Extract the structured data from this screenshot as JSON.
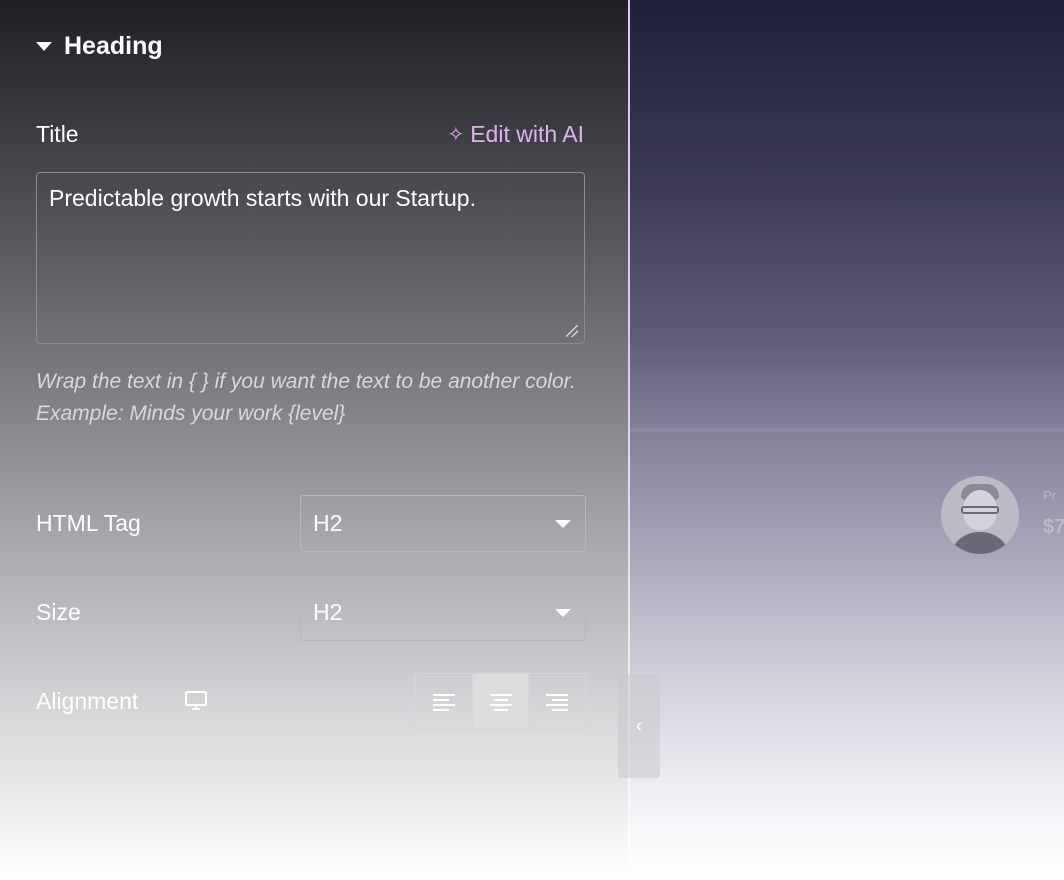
{
  "section": {
    "title": "Heading",
    "icon": "caret-down-icon"
  },
  "title_field": {
    "label": "Title",
    "ai_label": "Edit with AI",
    "ai_icon": "sparkle-icon",
    "value": "Predictable growth starts with our Startup."
  },
  "hint": {
    "line1": "Wrap the text in { } if you want the text to be another color.",
    "line2": "Example: Minds your work {level}"
  },
  "html_tag": {
    "label": "HTML Tag",
    "value": "H2"
  },
  "size": {
    "label": "Size",
    "value": "H2"
  },
  "alignment": {
    "label": "Alignment",
    "device_icon": "desktop-icon",
    "options": [
      "align-left-icon",
      "align-center-icon",
      "align-right-icon"
    ],
    "selected": "center"
  },
  "panel_toggle": {
    "icon": "chevron-left-icon",
    "glyph": "‹"
  },
  "preview": {
    "price_label": "Pr",
    "price": "$7"
  },
  "colors": {
    "accent": "#e2b0f0",
    "divider": "#e7c4ec"
  }
}
